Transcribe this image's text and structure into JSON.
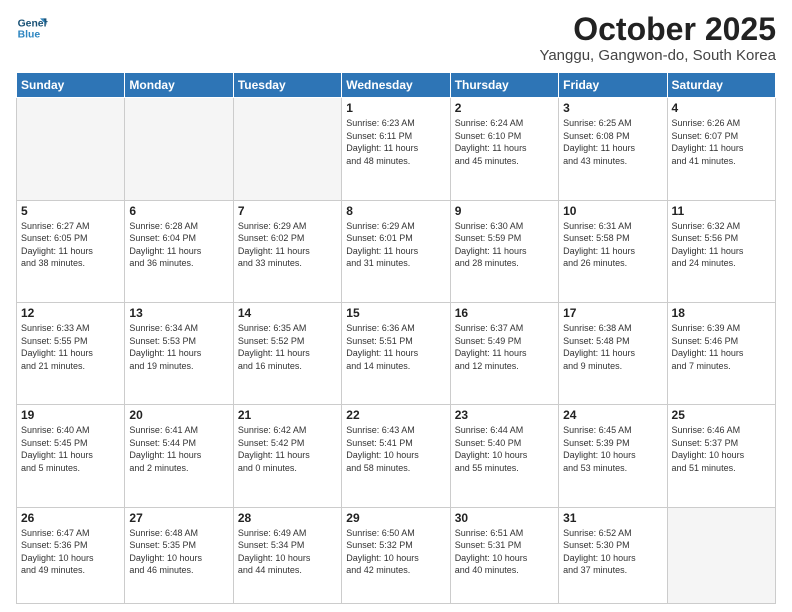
{
  "logo": {
    "line1": "General",
    "line2": "Blue"
  },
  "title": "October 2025",
  "subtitle": "Yanggu, Gangwon-do, South Korea",
  "weekdays": [
    "Sunday",
    "Monday",
    "Tuesday",
    "Wednesday",
    "Thursday",
    "Friday",
    "Saturday"
  ],
  "weeks": [
    [
      {
        "day": "",
        "info": ""
      },
      {
        "day": "",
        "info": ""
      },
      {
        "day": "",
        "info": ""
      },
      {
        "day": "1",
        "info": "Sunrise: 6:23 AM\nSunset: 6:11 PM\nDaylight: 11 hours\nand 48 minutes."
      },
      {
        "day": "2",
        "info": "Sunrise: 6:24 AM\nSunset: 6:10 PM\nDaylight: 11 hours\nand 45 minutes."
      },
      {
        "day": "3",
        "info": "Sunrise: 6:25 AM\nSunset: 6:08 PM\nDaylight: 11 hours\nand 43 minutes."
      },
      {
        "day": "4",
        "info": "Sunrise: 6:26 AM\nSunset: 6:07 PM\nDaylight: 11 hours\nand 41 minutes."
      }
    ],
    [
      {
        "day": "5",
        "info": "Sunrise: 6:27 AM\nSunset: 6:05 PM\nDaylight: 11 hours\nand 38 minutes."
      },
      {
        "day": "6",
        "info": "Sunrise: 6:28 AM\nSunset: 6:04 PM\nDaylight: 11 hours\nand 36 minutes."
      },
      {
        "day": "7",
        "info": "Sunrise: 6:29 AM\nSunset: 6:02 PM\nDaylight: 11 hours\nand 33 minutes."
      },
      {
        "day": "8",
        "info": "Sunrise: 6:29 AM\nSunset: 6:01 PM\nDaylight: 11 hours\nand 31 minutes."
      },
      {
        "day": "9",
        "info": "Sunrise: 6:30 AM\nSunset: 5:59 PM\nDaylight: 11 hours\nand 28 minutes."
      },
      {
        "day": "10",
        "info": "Sunrise: 6:31 AM\nSunset: 5:58 PM\nDaylight: 11 hours\nand 26 minutes."
      },
      {
        "day": "11",
        "info": "Sunrise: 6:32 AM\nSunset: 5:56 PM\nDaylight: 11 hours\nand 24 minutes."
      }
    ],
    [
      {
        "day": "12",
        "info": "Sunrise: 6:33 AM\nSunset: 5:55 PM\nDaylight: 11 hours\nand 21 minutes."
      },
      {
        "day": "13",
        "info": "Sunrise: 6:34 AM\nSunset: 5:53 PM\nDaylight: 11 hours\nand 19 minutes."
      },
      {
        "day": "14",
        "info": "Sunrise: 6:35 AM\nSunset: 5:52 PM\nDaylight: 11 hours\nand 16 minutes."
      },
      {
        "day": "15",
        "info": "Sunrise: 6:36 AM\nSunset: 5:51 PM\nDaylight: 11 hours\nand 14 minutes."
      },
      {
        "day": "16",
        "info": "Sunrise: 6:37 AM\nSunset: 5:49 PM\nDaylight: 11 hours\nand 12 minutes."
      },
      {
        "day": "17",
        "info": "Sunrise: 6:38 AM\nSunset: 5:48 PM\nDaylight: 11 hours\nand 9 minutes."
      },
      {
        "day": "18",
        "info": "Sunrise: 6:39 AM\nSunset: 5:46 PM\nDaylight: 11 hours\nand 7 minutes."
      }
    ],
    [
      {
        "day": "19",
        "info": "Sunrise: 6:40 AM\nSunset: 5:45 PM\nDaylight: 11 hours\nand 5 minutes."
      },
      {
        "day": "20",
        "info": "Sunrise: 6:41 AM\nSunset: 5:44 PM\nDaylight: 11 hours\nand 2 minutes."
      },
      {
        "day": "21",
        "info": "Sunrise: 6:42 AM\nSunset: 5:42 PM\nDaylight: 11 hours\nand 0 minutes."
      },
      {
        "day": "22",
        "info": "Sunrise: 6:43 AM\nSunset: 5:41 PM\nDaylight: 10 hours\nand 58 minutes."
      },
      {
        "day": "23",
        "info": "Sunrise: 6:44 AM\nSunset: 5:40 PM\nDaylight: 10 hours\nand 55 minutes."
      },
      {
        "day": "24",
        "info": "Sunrise: 6:45 AM\nSunset: 5:39 PM\nDaylight: 10 hours\nand 53 minutes."
      },
      {
        "day": "25",
        "info": "Sunrise: 6:46 AM\nSunset: 5:37 PM\nDaylight: 10 hours\nand 51 minutes."
      }
    ],
    [
      {
        "day": "26",
        "info": "Sunrise: 6:47 AM\nSunset: 5:36 PM\nDaylight: 10 hours\nand 49 minutes."
      },
      {
        "day": "27",
        "info": "Sunrise: 6:48 AM\nSunset: 5:35 PM\nDaylight: 10 hours\nand 46 minutes."
      },
      {
        "day": "28",
        "info": "Sunrise: 6:49 AM\nSunset: 5:34 PM\nDaylight: 10 hours\nand 44 minutes."
      },
      {
        "day": "29",
        "info": "Sunrise: 6:50 AM\nSunset: 5:32 PM\nDaylight: 10 hours\nand 42 minutes."
      },
      {
        "day": "30",
        "info": "Sunrise: 6:51 AM\nSunset: 5:31 PM\nDaylight: 10 hours\nand 40 minutes."
      },
      {
        "day": "31",
        "info": "Sunrise: 6:52 AM\nSunset: 5:30 PM\nDaylight: 10 hours\nand 37 minutes."
      },
      {
        "day": "",
        "info": ""
      }
    ]
  ]
}
